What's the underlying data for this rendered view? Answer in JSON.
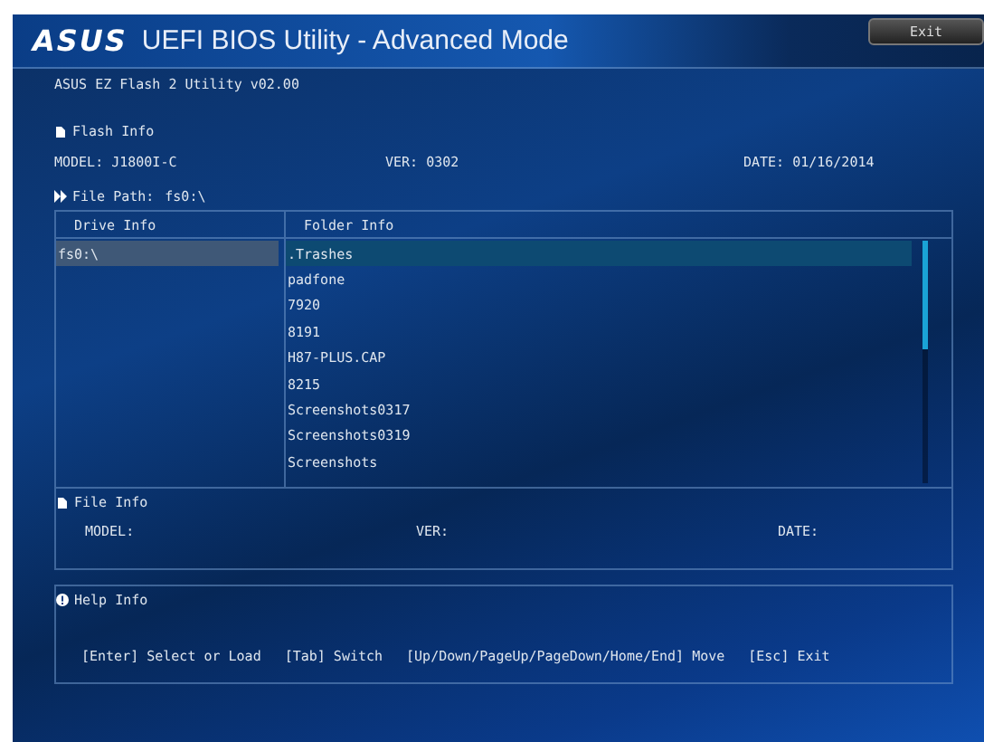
{
  "header": {
    "logo": "ASUS",
    "title": "UEFI BIOS Utility - Advanced Mode",
    "exit_button": "Exit"
  },
  "utility_name": "ASUS EZ Flash 2 Utility v02.00",
  "flash_info": {
    "heading": "Flash Info",
    "model": "MODEL: J1800I-C",
    "ver": "VER: 0302",
    "date": "DATE: 01/16/2014"
  },
  "file_path": {
    "label": "File Path:",
    "value": "fs0:\\"
  },
  "browser": {
    "drive_heading": "Drive Info",
    "folder_heading": "Folder Info",
    "drives": [
      {
        "name": "fs0:\\",
        "selected": true
      }
    ],
    "folders": [
      {
        "name": ".Trashes",
        "selected": true
      },
      {
        "name": "padfone",
        "selected": false
      },
      {
        "name": "7920",
        "selected": false
      },
      {
        "name": "8191",
        "selected": false
      },
      {
        "name": "H87-PLUS.CAP",
        "selected": false
      },
      {
        "name": "8215",
        "selected": false
      },
      {
        "name": "Screenshots0317",
        "selected": false
      },
      {
        "name": "Screenshots0319",
        "selected": false
      },
      {
        "name": "Screenshots",
        "selected": false
      }
    ]
  },
  "file_info": {
    "heading": "File Info",
    "model": "MODEL:",
    "ver": "VER:",
    "date": "DATE:"
  },
  "help_info": {
    "heading": "Help Info",
    "keys": [
      "[Enter] Select or Load",
      "[Tab] Switch",
      "[Up/Down/PageUp/PageDown/Home/End] Move",
      "[Esc] Exit"
    ]
  }
}
